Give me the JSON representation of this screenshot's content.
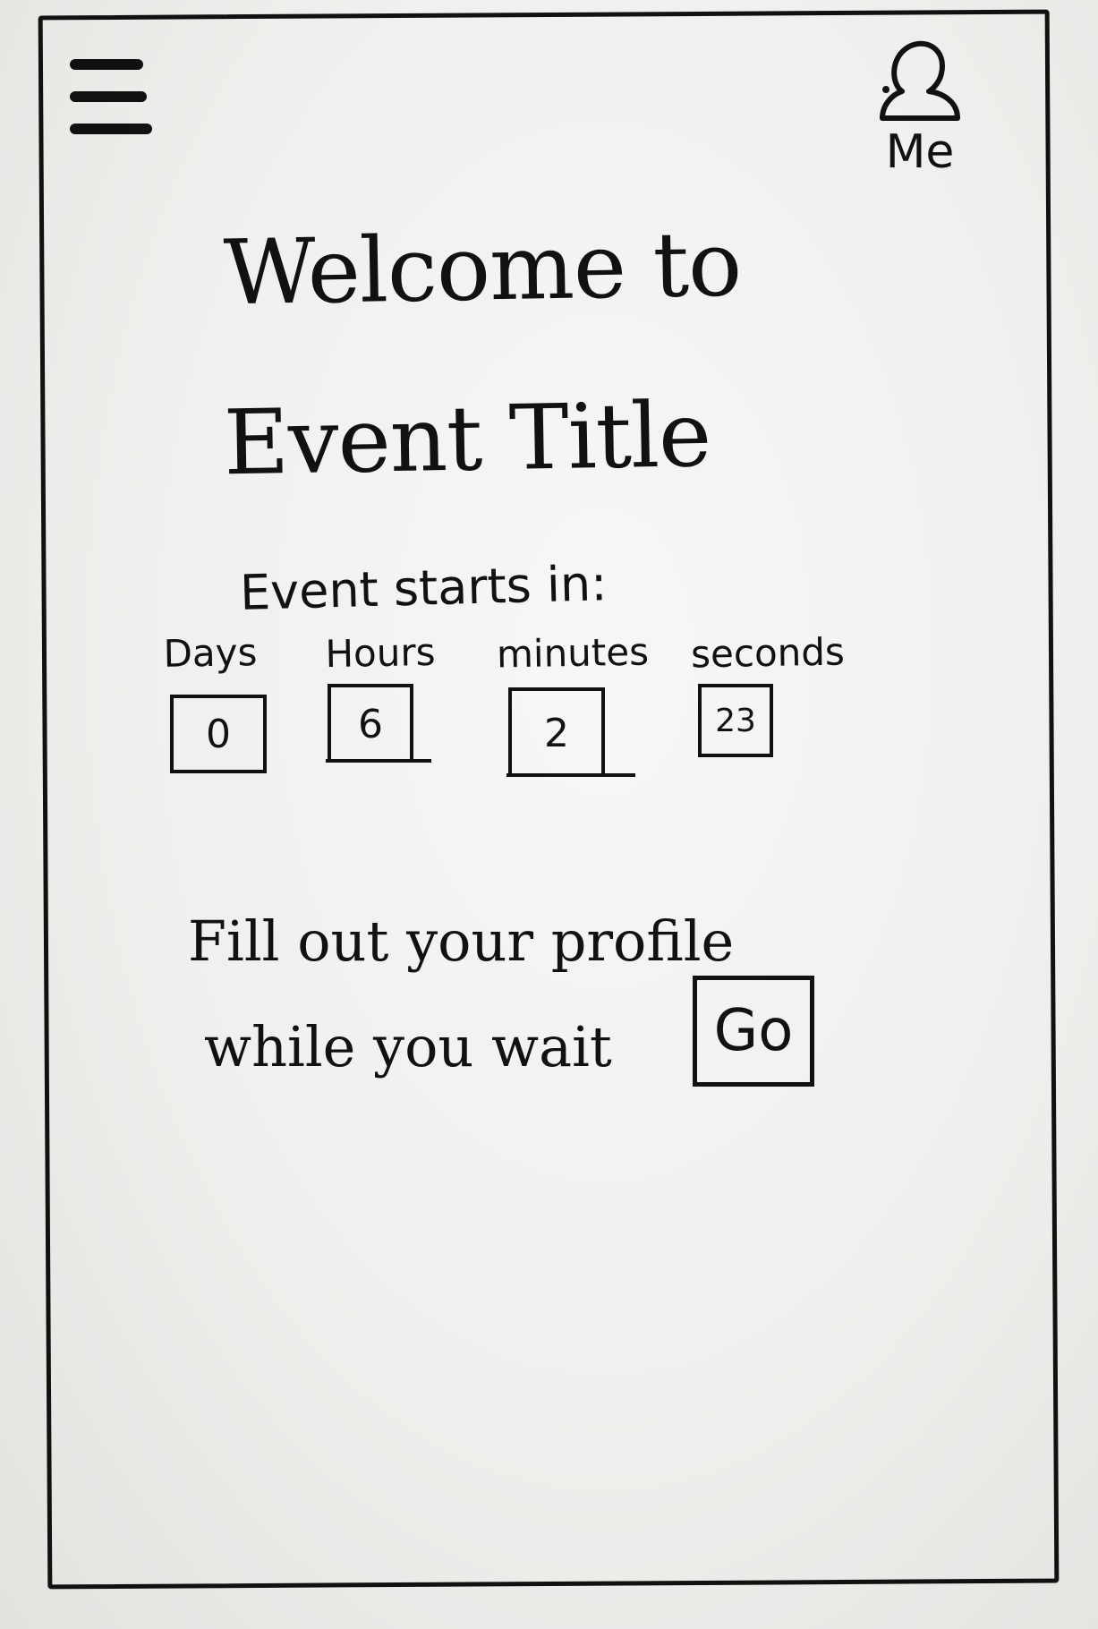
{
  "header": {
    "menu_icon": "hamburger-menu-icon",
    "profile_icon": "user-icon",
    "profile_label": "Me"
  },
  "main": {
    "welcome_line": "Welcome to",
    "event_title": "Event Title",
    "starts_label": "Event starts in:",
    "countdown": [
      {
        "label": "Days",
        "value": "0"
      },
      {
        "label": "Hours",
        "value": "6"
      },
      {
        "label": "minutes",
        "value": "2"
      },
      {
        "label": "seconds",
        "value": "23"
      }
    ],
    "profile_prompt_line1": "Fill out your profile",
    "profile_prompt_line2": "while you wait",
    "go_label": "Go"
  },
  "colors": {
    "ink": "#111111",
    "paper": "#f3f3f1"
  }
}
